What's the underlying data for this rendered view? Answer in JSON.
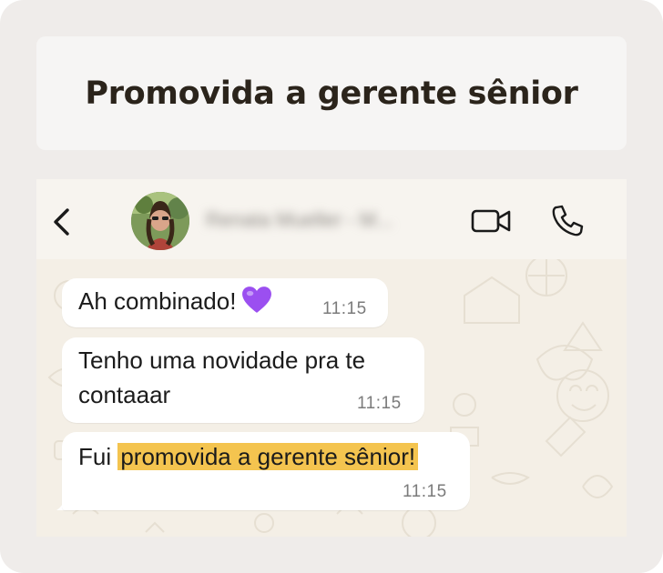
{
  "title": "Promovida a gerente sênior",
  "chat": {
    "contact_name": "Renata Mueller - M...",
    "messages": [
      {
        "text": "Ah combinado!",
        "emoji": "purple-heart",
        "time": "11:15"
      },
      {
        "text_line1": "Tenho uma novidade pra te",
        "text_line2": "contaaar",
        "time": "11:15"
      },
      {
        "prefix": "Fui ",
        "highlight": "promovida a gerente sênior!",
        "time": "11:15"
      }
    ]
  },
  "colors": {
    "highlight": "#f4c44f",
    "heart": "#9b4ff0",
    "background": "#efecea",
    "chat_wallpaper": "#f4efe6"
  }
}
